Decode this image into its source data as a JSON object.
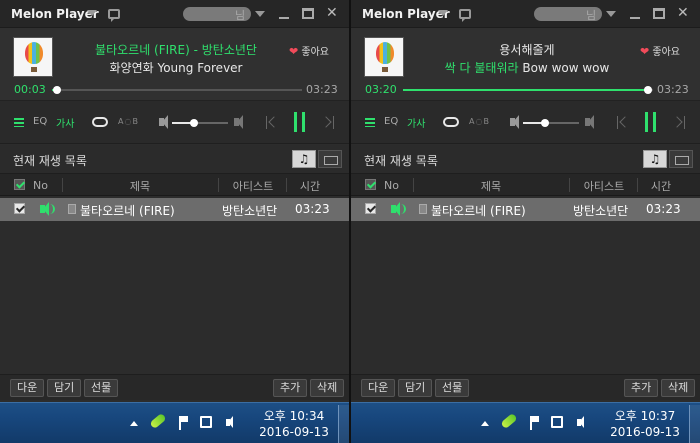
{
  "windows": [
    {
      "app_title": "Melon Player",
      "user_suffix": "님",
      "song": {
        "line1": "불타오르네 (FIRE) - 방탄소년단",
        "line2": "화양연화 Young Forever",
        "line1_color": "green",
        "line2_color": "white"
      },
      "like_label": "좋아요",
      "time_current": "00:03",
      "time_total": "03:23",
      "progress_percent": 2,
      "volume_percent": 40,
      "eq_label": "EQ",
      "lyrics_label": "가사",
      "ab_label": "A◌B",
      "playlist": {
        "title": "현재 재생 목록",
        "columns": {
          "no": "No",
          "title": "제목",
          "artist": "아티스트",
          "time": "시간"
        },
        "tracks": [
          {
            "title": "불타오르네 (FIRE)",
            "artist": "방탄소년단",
            "time": "03:23"
          }
        ]
      },
      "bottom_buttons": {
        "play": "다운",
        "add_to": "담기",
        "gift": "선물",
        "add": "추가",
        "delete": "삭제"
      },
      "taskbar": {
        "time": "오후 10:34",
        "date": "2016-09-13"
      }
    },
    {
      "app_title": "Melon Player",
      "user_suffix": "님",
      "song": {
        "line1": "용서해줄게",
        "line2_green": "싹 다 불태워라",
        "line2_white": " Bow wow wow"
      },
      "like_label": "좋아요",
      "time_current": "03:20",
      "time_total": "03:23",
      "progress_percent": 98,
      "volume_percent": 40,
      "eq_label": "EQ",
      "lyrics_label": "가사",
      "ab_label": "A◌B",
      "playlist": {
        "title": "현재 재생 목록",
        "columns": {
          "no": "No",
          "title": "제목",
          "artist": "아티스트",
          "time": "시간"
        },
        "tracks": [
          {
            "title": "불타오르네 (FIRE)",
            "artist": "방탄소년단",
            "time": "03:23"
          }
        ]
      },
      "bottom_buttons": {
        "play": "다운",
        "add_to": "담기",
        "gift": "선물",
        "add": "추가",
        "delete": "삭제"
      },
      "taskbar": {
        "time": "오후 10:37",
        "date": "2016-09-13"
      }
    }
  ],
  "colors": {
    "accent": "#2fe06d",
    "heart": "#f14b5a",
    "taskbar": "#17467c"
  },
  "icons": [
    "chat-icon",
    "minimize-icon",
    "mini-mode-icon",
    "close-icon",
    "heart-icon",
    "playlist-icon",
    "repeat-icon",
    "volume-icon",
    "prev-icon",
    "pause-icon",
    "next-icon",
    "music-tab-icon",
    "video-tab-icon",
    "checkbox-icon",
    "speaker-icon",
    "document-icon",
    "tray-up-icon",
    "melon-tray-icon",
    "flag-icon",
    "network-icon",
    "tray-volume-icon"
  ]
}
